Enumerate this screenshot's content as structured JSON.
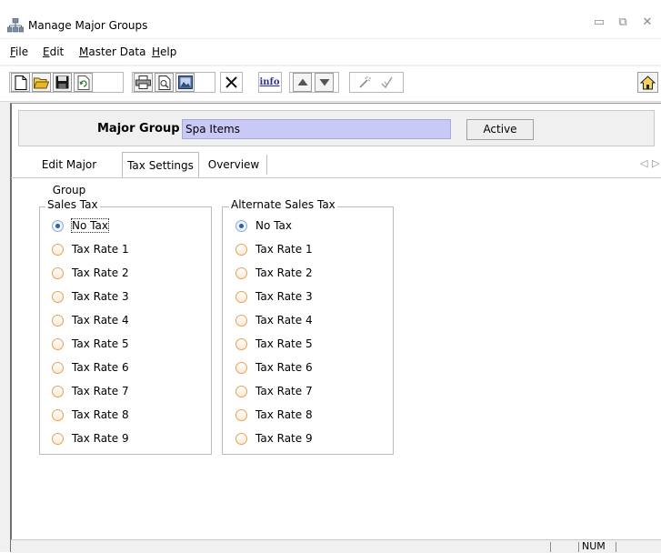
{
  "window": {
    "title": "Manage Major Groups",
    "controls": {
      "minimize": "▭",
      "restore": "⧉",
      "close": "✕"
    }
  },
  "menu": {
    "items": [
      {
        "label": "File"
      },
      {
        "label": "Edit"
      },
      {
        "label": "Master Data"
      },
      {
        "label": "Help"
      }
    ]
  },
  "toolbar": {
    "info_label": "info",
    "icons": [
      "new-document-icon",
      "open-folder-icon",
      "save-icon",
      "refresh-icon",
      "print-icon",
      "print-preview-icon",
      "image-icon",
      "delete-icon",
      "info-icon",
      "move-up-icon",
      "move-down-icon",
      "wand-icon",
      "check-icon",
      "home-icon"
    ]
  },
  "header": {
    "major_group_label": "Major Group",
    "major_group_value": "Spa Items",
    "status_label": "Active",
    "field_color": "#c9c9f7"
  },
  "tabs": [
    {
      "label": "Edit Major Group",
      "active": false
    },
    {
      "label": "Tax Settings",
      "active": true
    },
    {
      "label": "Overview",
      "active": false
    }
  ],
  "sales_tax": {
    "title": "Sales Tax",
    "options": [
      "No Tax",
      "Tax Rate 1",
      "Tax Rate 2",
      "Tax Rate 3",
      "Tax Rate 4",
      "Tax Rate 5",
      "Tax Rate 6",
      "Tax Rate 7",
      "Tax Rate 8",
      "Tax Rate 9"
    ],
    "selected": "No Tax"
  },
  "alternate_sales_tax": {
    "title": "Alternate Sales Tax",
    "options": [
      "No Tax",
      "Tax Rate 1",
      "Tax Rate 2",
      "Tax Rate 3",
      "Tax Rate 4",
      "Tax Rate 5",
      "Tax Rate 6",
      "Tax Rate 7",
      "Tax Rate 8",
      "Tax Rate 9"
    ],
    "selected": "No Tax"
  },
  "status_bar": {
    "num_indicator": "NUM"
  }
}
